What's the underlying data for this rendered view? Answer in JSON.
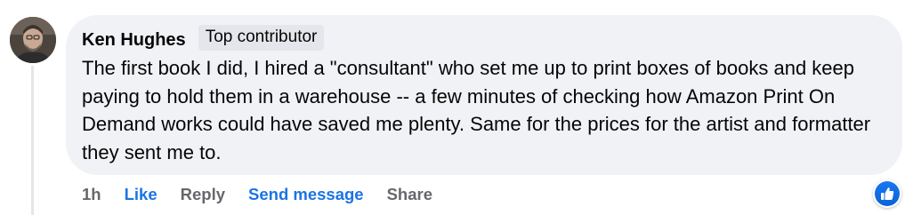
{
  "comment": {
    "author": "Ken Hughes",
    "badge": "Top contributor",
    "text": "The first book I did, I hired a \"consultant\" who set me up to print boxes of books and keep paying to hold them in a warehouse -- a few minutes of checking how Amazon Print On Demand works could have saved me plenty. Same for the prices for the artist and formatter they sent me to.",
    "time": "1h",
    "actions": {
      "like": "Like",
      "reply": "Reply",
      "send_message": "Send message",
      "share": "Share"
    },
    "reaction_icon": "thumbs-up-icon"
  },
  "colors": {
    "bubble": "#f0f2f5",
    "accent": "#1b74e4",
    "muted": "#65676b"
  }
}
